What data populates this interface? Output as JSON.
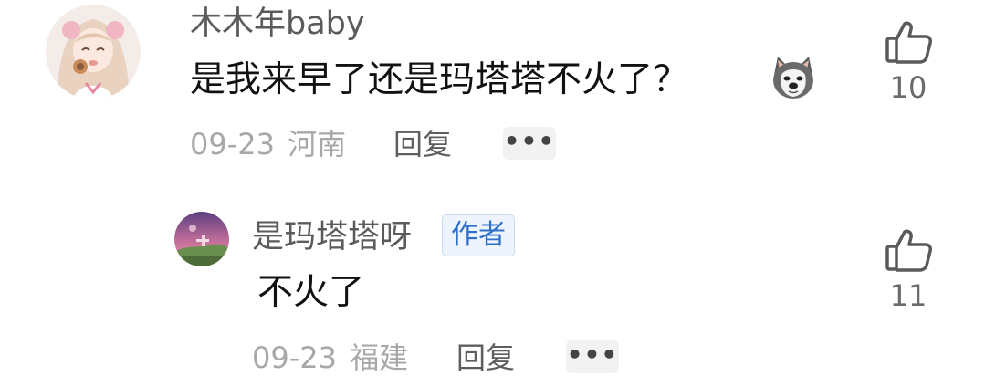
{
  "comment": {
    "username": "木木年baby",
    "text": "是我来早了还是玛塔塔不火了？",
    "emoji_icon": "husky-doge-emoji",
    "date": "09-23",
    "location": "河南",
    "reply_label": "回复",
    "more_label": "•••",
    "like_count": "10"
  },
  "reply": {
    "username": "是玛塔塔呀",
    "author_badge": "作者",
    "text": "不火了",
    "date": "09-23",
    "location": "福建",
    "reply_label": "回复",
    "more_label": "•••",
    "like_count": "11"
  },
  "colors": {
    "username": "#5b5b5b",
    "content": "#111111",
    "meta": "#a8a8a8",
    "badge_text": "#2f6fcb",
    "badge_bg": "#eef4fc"
  }
}
